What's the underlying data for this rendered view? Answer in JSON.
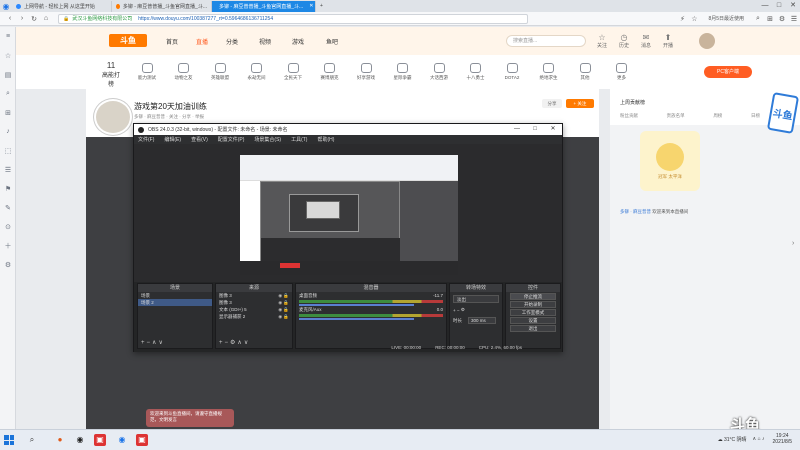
{
  "browser": {
    "tabs": [
      {
        "label": "上网导航 - 轻松上网 从这里开始",
        "active": false
      },
      {
        "label": "多铆 - 麻豆普普播_斗鱼官网直播_斗...",
        "active": false
      },
      {
        "label": "多铆 - 麻豆普普播_斗鱼官网直播_斗...",
        "active": true
      }
    ],
    "secure_label": "🔒",
    "site_name": "武汉斗鱼网络科技有限公司",
    "url": "https://www.douyu.com/100387277_rt=0.5964686136711254",
    "news_label": "8月5日最近使用",
    "window_controls": [
      "—",
      "□",
      "✕"
    ]
  },
  "douyu": {
    "logo": "斗鱼",
    "nav": [
      "首页",
      "直播",
      "分类",
      "视频",
      "游戏",
      "鱼吧"
    ],
    "active_nav": "直播",
    "search_placeholder": "搜索直播...",
    "header_icons": [
      {
        "icon": "☆",
        "label": "关注"
      },
      {
        "icon": "◷",
        "label": "历史"
      },
      {
        "icon": "✉",
        "label": "消息"
      },
      {
        "icon": "⬆",
        "label": "开播"
      }
    ],
    "day_label": "11",
    "day_sub": "高能打榜",
    "categories": [
      "能力测试",
      "动物之友",
      "英雄联盟",
      "永劫无间",
      "全民天下",
      "赛博朋克",
      "好享游戏",
      "星际争霸",
      "大话西游",
      "十八勇士",
      "DOTA2",
      "绝地求生",
      "其他",
      "更多"
    ],
    "pc_button": "PC客户端",
    "room": {
      "title": "游戏第20天加油训练",
      "meta": "多铆 · 麻豆普普 · 关注 · 分享 · 举报",
      "btn1": "分享",
      "follow": "+ 关注"
    },
    "chat_overlay": "欢迎来到斗鱼直播间，请遵守直播规范，文明发言",
    "right_panel": {
      "rank_title": "上周贡献榜",
      "tabs": [
        "粉丝贡献",
        "贵族名单",
        "周榜",
        "日榜"
      ],
      "sticker_text": "冠军 太平洋",
      "welcome_user": "多铆 · 麻豆普普",
      "welcome_text": "欢迎来到本直播间"
    },
    "side_badge": "斗鱼",
    "watermark": "斗鱼"
  },
  "left_sidebar": {
    "icons": [
      "≡",
      "☆",
      "▤",
      "⌕",
      "⊞",
      "♪",
      "⬚",
      "☰",
      "⚑",
      "✎",
      "⊙",
      "＋",
      "⚙"
    ]
  },
  "obs": {
    "title": "OBS 24.0.3 (32-bit, windows) - 配置文件: 未命名 - 场景: 未命名",
    "menu": [
      "文件(F)",
      "编辑(E)",
      "查看(V)",
      "配置文件(P)",
      "场景集合(S)",
      "工具(T)",
      "帮助(H)"
    ],
    "docks": {
      "scenes": {
        "title": "场景",
        "items": [
          "场景",
          "场景 2"
        ],
        "selected": 1
      },
      "sources": {
        "title": "来源",
        "items": [
          "图像 3",
          "图像 3",
          "文本 (GDI+) 5",
          "显示器捕获 2"
        ]
      },
      "mixer": {
        "title": "混音器",
        "rows": [
          {
            "name": "桌面音频",
            "db": "-11.7"
          },
          {
            "name": "麦克风/Aux",
            "db": "0.0"
          }
        ]
      },
      "transitions": {
        "title": "转场特效",
        "selected": "淡出",
        "duration_label": "时长",
        "duration_value": "300 ms"
      },
      "controls": {
        "title": "控件",
        "buttons": [
          "停止推流",
          "开始录制",
          "工作室模式",
          "设置",
          "退出"
        ]
      }
    },
    "status": {
      "live": "LIVE: 00:00:00",
      "rec": "REC: 00:00:00",
      "cpu": "CPU: 2.4%, 60.00 fps"
    }
  },
  "taskbar": {
    "temperature": "31°C",
    "weather": "阴晴",
    "time": "19:24",
    "date": "2021/8/5"
  },
  "colors": {
    "accent": "#ff7a00",
    "brand_blue": "#1e88e5"
  }
}
